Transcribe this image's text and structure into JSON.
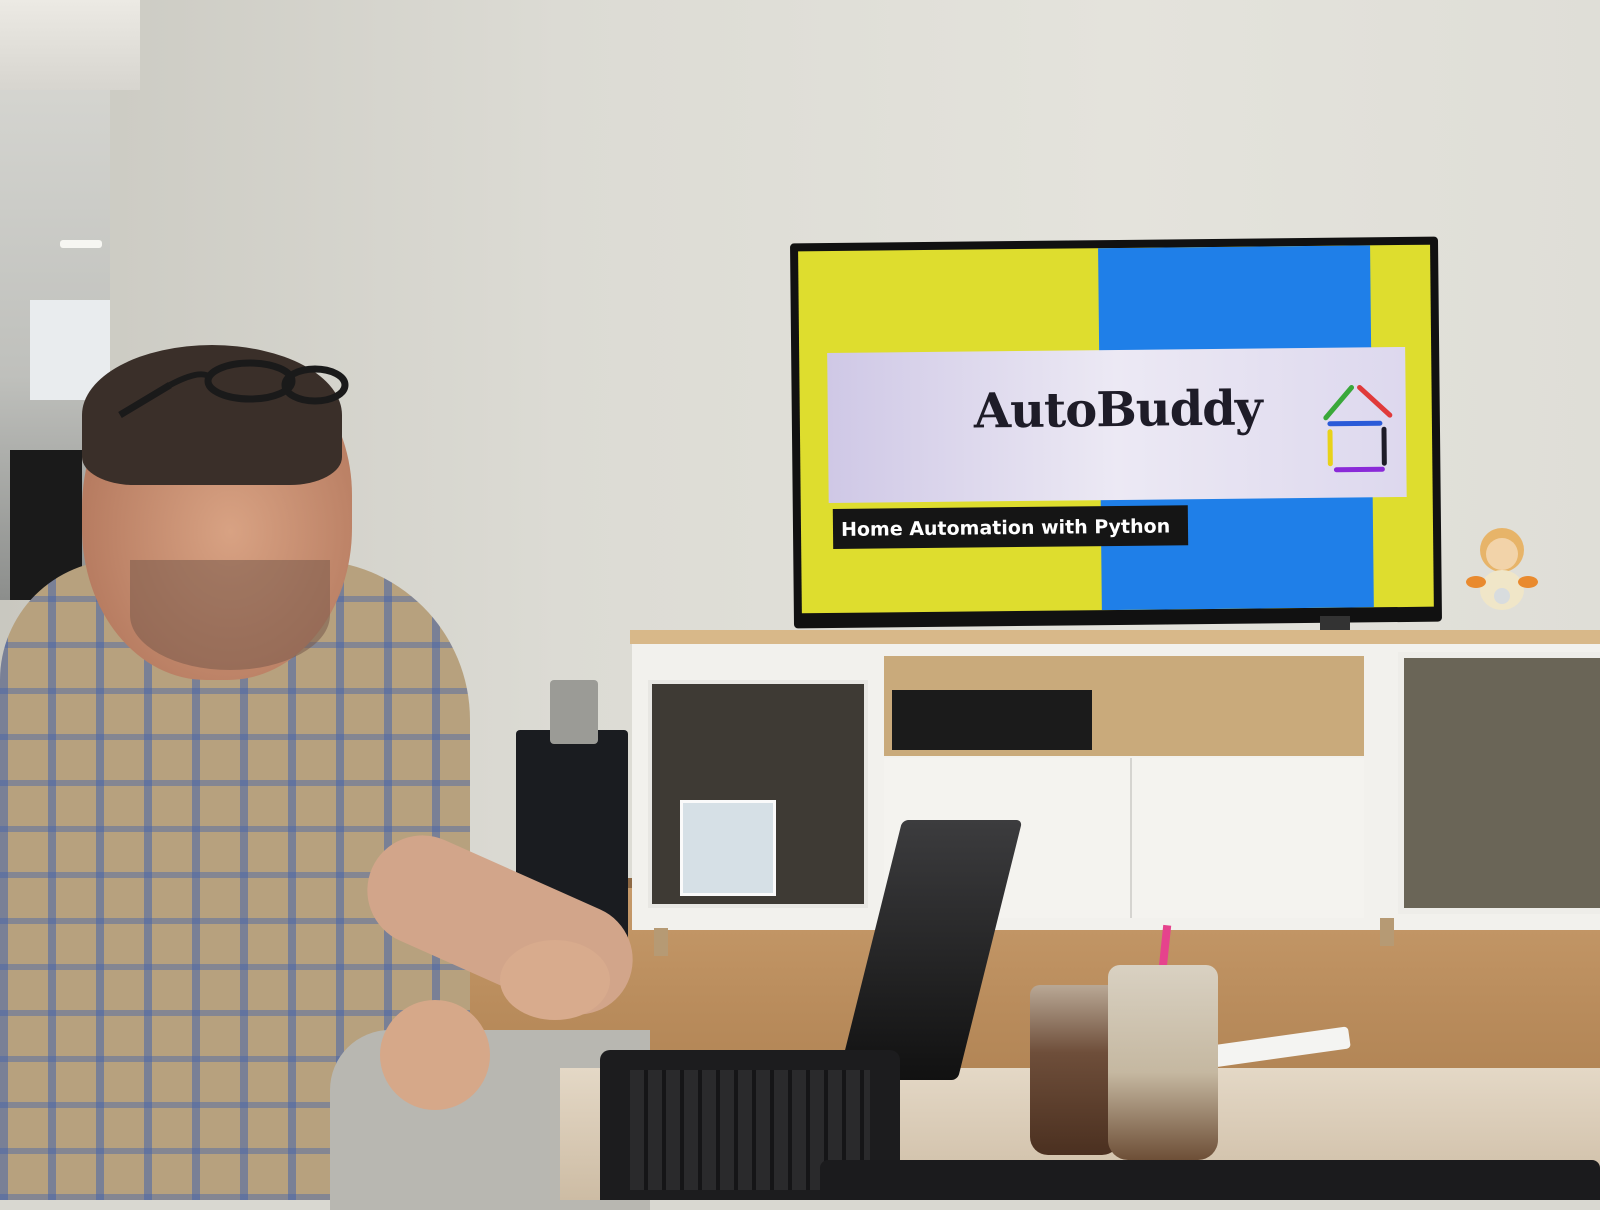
{
  "tv_slide": {
    "title": "AutoBuddy",
    "subtitle": "Home Automation with Python",
    "colors": {
      "left_panel": "#dedd2e",
      "right_panel": "#1f7fe8",
      "banner": "#e6e2f2",
      "subtitle_bg": "#151515",
      "logo_green": "#3aa83a",
      "logo_red": "#e03a3a",
      "logo_blue": "#2a5ad8",
      "logo_black": "#1e1c28",
      "logo_yellow": "#e8d21a",
      "logo_purple": "#8a2ad8"
    },
    "logo_icon": "house-icon"
  }
}
